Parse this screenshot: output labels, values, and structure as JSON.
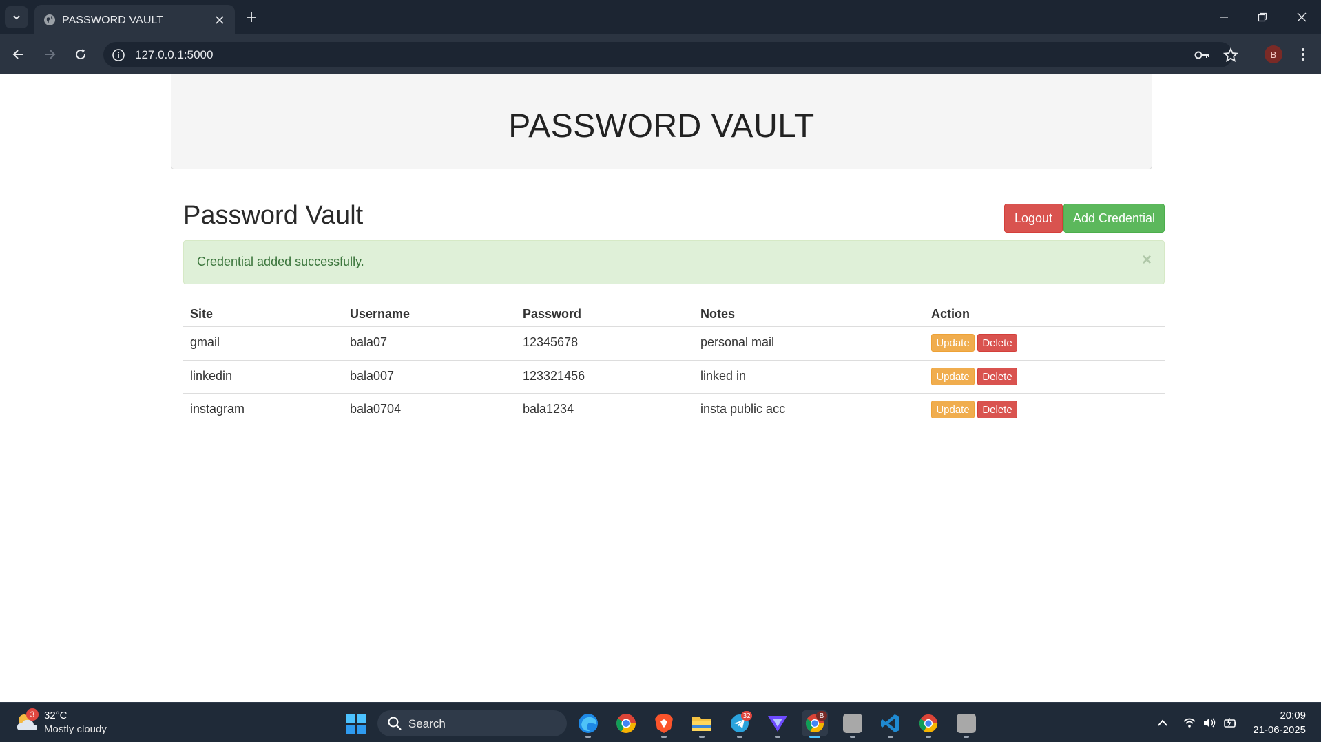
{
  "browser": {
    "tab_title": "PASSWORD VAULT",
    "url": "127.0.0.1:5000",
    "profile_initial": "B"
  },
  "page": {
    "jumbotron_title": "PASSWORD VAULT",
    "heading": "Password Vault",
    "logout_label": "Logout",
    "add_label": "Add Credential",
    "alert_text": "Credential added successfully.",
    "alert_close": "×"
  },
  "table": {
    "headers": [
      "Site",
      "Username",
      "Password",
      "Notes",
      "Action"
    ],
    "rows": [
      {
        "site": "gmail",
        "username": "bala07",
        "password": "12345678",
        "notes": "personal mail"
      },
      {
        "site": "linkedin",
        "username": "bala007",
        "password": "123321456",
        "notes": "linked in"
      },
      {
        "site": "instagram",
        "username": "bala0704",
        "password": "bala1234",
        "notes": "insta public acc"
      }
    ],
    "update_label": "Update",
    "delete_label": "Delete"
  },
  "taskbar": {
    "weather_badge": "3",
    "temperature": "32°C",
    "weather": "Mostly cloudy",
    "search_label": "Search",
    "telegram_badge": "32",
    "chrome_profile_badge": "B",
    "time": "20:09",
    "date": "21-06-2025"
  },
  "colors": {
    "danger": "#d9534f",
    "success": "#5cb85c",
    "warning": "#f0ad4e",
    "alert_bg": "#dff0d8",
    "chrome_dark": "#1c2532"
  }
}
